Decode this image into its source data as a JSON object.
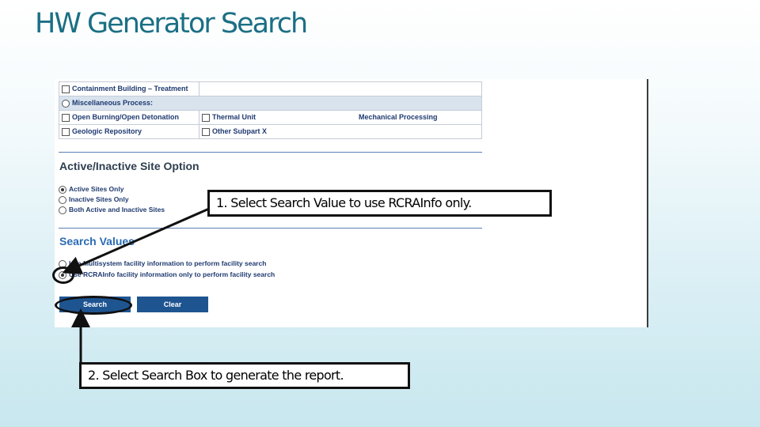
{
  "slide": {
    "title": "HW Generator Search"
  },
  "process_table": {
    "rows": [
      {
        "cells": [
          "Containment Building – Treatment",
          ""
        ]
      },
      {
        "cells": [
          "Miscellaneous Process:"
        ]
      },
      {
        "cells": [
          "Open Burning/Open Detonation",
          "Thermal Unit",
          "Mechanical Processing"
        ]
      },
      {
        "cells": [
          "Geologic Repository",
          "Other Subpart X"
        ]
      }
    ]
  },
  "active_section": {
    "heading": "Active/Inactive Site Option",
    "options": [
      {
        "label": "Active Sites Only",
        "selected": true
      },
      {
        "label": "Inactive Sites Only",
        "selected": false
      },
      {
        "label": "Both Active and Inactive Sites",
        "selected": false
      }
    ]
  },
  "search_values": {
    "heading": "Search Values",
    "options": [
      {
        "label": "Use Multisystem facility information to perform facility search",
        "selected": false
      },
      {
        "label": "Use RCRAInfo facility information only to perform facility search",
        "selected": true
      }
    ]
  },
  "buttons": {
    "search_label": "Search",
    "clear_label": "Clear"
  },
  "callouts": {
    "step1": "1.  Select Search Value to  use RCRAInfo only.",
    "step2": "2.  Select Search Box to generate the report."
  }
}
